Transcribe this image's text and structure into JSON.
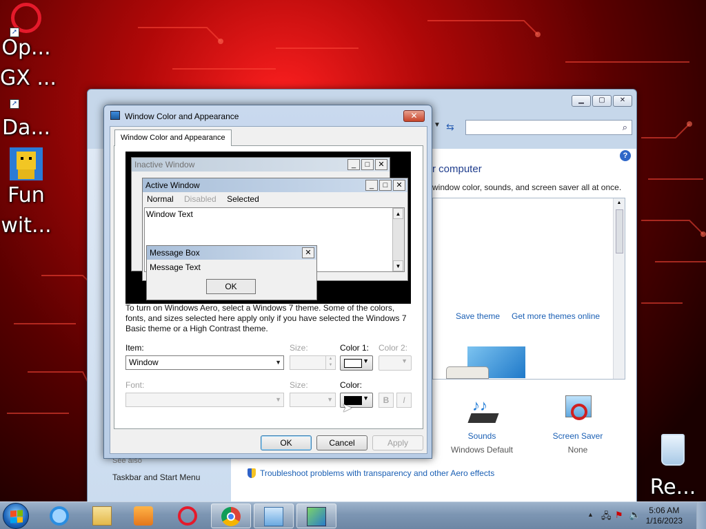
{
  "desktop": {
    "icons": [
      {
        "label": "Op..."
      },
      {
        "label": "GX ..."
      },
      {
        "label": "Da..."
      },
      {
        "label": "Fun"
      },
      {
        "label": "wit..."
      },
      {
        "label": "Re..."
      }
    ]
  },
  "personalization": {
    "heading": "r computer",
    "subtitle": "window color, sounds, and screen saver all at once.",
    "save_theme": "Save theme",
    "more_themes": "Get more themes online",
    "sounds_label": "Sounds",
    "sounds_value": "Windows Default",
    "screensaver_label": "Screen Saver",
    "screensaver_value": "None",
    "see_also": "See also",
    "taskbar_link": "Taskbar and Start Menu",
    "troubleshoot": "Troubleshoot problems with transparency and other Aero effects",
    "help": "?"
  },
  "dialog": {
    "title": "Window Color and Appearance",
    "tab": "Window Color and Appearance",
    "close": "✕",
    "preview": {
      "inactive_title": "Inactive Window",
      "active_title": "Active Window",
      "menu_normal": "Normal",
      "menu_disabled": "Disabled",
      "menu_selected": "Selected",
      "window_text": "Window Text",
      "msgbox_title": "Message Box",
      "msgbox_text": "Message Text",
      "msgbox_ok": "OK"
    },
    "description": "To turn on Windows Aero, select a Windows 7 theme.  Some of the colors, fonts, and sizes selected here apply only if you have selected the Windows 7 Basic theme or a High Contrast theme.",
    "item_label": "Item:",
    "item_value": "Window",
    "size_label": "Size:",
    "color1_label": "Color 1:",
    "color2_label": "Color 2:",
    "font_label": "Font:",
    "size2_label": "Size:",
    "color_label": "Color:",
    "bold": "B",
    "italic": "I",
    "ok": "OK",
    "cancel": "Cancel",
    "apply": "Apply",
    "color1_swatch": "#ffffff",
    "color_swatch": "#000000"
  },
  "taskbar": {
    "time": "5:06 AM",
    "date": "1/16/2023",
    "apps": [
      "internet-explorer-icon",
      "file-explorer-icon",
      "media-player-icon",
      "opera-gx-icon",
      "chrome-icon",
      "control-panel-icon",
      "personalization-icon"
    ]
  }
}
